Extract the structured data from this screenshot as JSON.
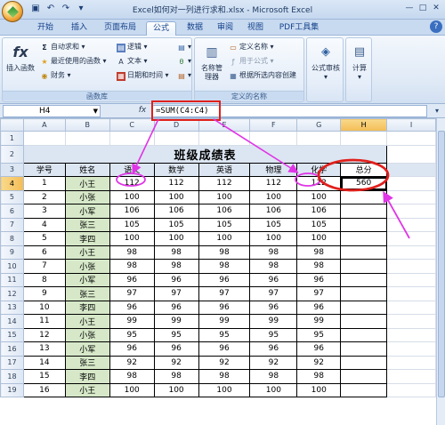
{
  "window": {
    "title": "Excel如何对一列进行求和.xlsx - Microsoft Excel"
  },
  "tabs": [
    "开始",
    "插入",
    "页面布局",
    "公式",
    "数据",
    "审阅",
    "视图",
    "PDF工具集"
  ],
  "active_tab": "公式",
  "ribbon": {
    "insert_function": "插入函数",
    "autosum": "自动求和",
    "recent": "最近使用的函数",
    "financial": "财务",
    "logical": "逻辑",
    "text": "文本",
    "datetime": "日期和时间",
    "name_manager": "名称管理器",
    "define_name": "定义名称",
    "use_in_formula": "用于公式",
    "create_from_selection": "根据所选内容创建",
    "formula_auditing": "公式审核",
    "calculation": "计算",
    "group_library": "函数库",
    "group_names": "定义的名称"
  },
  "formula_bar": {
    "name_box": "H4",
    "fx": "fx",
    "formula": "=SUM(C4:C4)"
  },
  "columns": [
    "A",
    "B",
    "C",
    "D",
    "E",
    "F",
    "G",
    "H",
    "I"
  ],
  "sheet": {
    "title": "班级成绩表",
    "headers": [
      "学号",
      "姓名",
      "语文",
      "数学",
      "英语",
      "物理",
      "化学",
      "总分"
    ],
    "rows": [
      [
        "1",
        "小王",
        "112",
        "112",
        "112",
        "112",
        "112",
        "560"
      ],
      [
        "2",
        "小张",
        "100",
        "100",
        "100",
        "100",
        "100",
        ""
      ],
      [
        "3",
        "小军",
        "106",
        "106",
        "106",
        "106",
        "106",
        ""
      ],
      [
        "4",
        "张三",
        "105",
        "105",
        "105",
        "105",
        "105",
        ""
      ],
      [
        "5",
        "李四",
        "100",
        "100",
        "100",
        "100",
        "100",
        ""
      ],
      [
        "6",
        "小王",
        "98",
        "98",
        "98",
        "98",
        "98",
        ""
      ],
      [
        "7",
        "小张",
        "98",
        "98",
        "98",
        "98",
        "98",
        ""
      ],
      [
        "8",
        "小军",
        "96",
        "96",
        "96",
        "96",
        "96",
        ""
      ],
      [
        "9",
        "张三",
        "97",
        "97",
        "97",
        "97",
        "97",
        ""
      ],
      [
        "10",
        "李四",
        "96",
        "96",
        "96",
        "96",
        "96",
        ""
      ],
      [
        "11",
        "小王",
        "99",
        "99",
        "99",
        "99",
        "99",
        ""
      ],
      [
        "12",
        "小张",
        "95",
        "95",
        "95",
        "95",
        "95",
        ""
      ],
      [
        "13",
        "小军",
        "96",
        "96",
        "96",
        "96",
        "96",
        ""
      ],
      [
        "14",
        "张三",
        "92",
        "92",
        "92",
        "92",
        "92",
        ""
      ],
      [
        "15",
        "李四",
        "98",
        "98",
        "98",
        "98",
        "98",
        ""
      ],
      [
        "16",
        "小王",
        "100",
        "100",
        "100",
        "100",
        "100",
        ""
      ]
    ]
  },
  "colors": {
    "annotation_magenta": "#e035e6",
    "annotation_red": "#e0201c",
    "name_fill": "#d6e8c8",
    "header_fill": "#dce6f2"
  }
}
